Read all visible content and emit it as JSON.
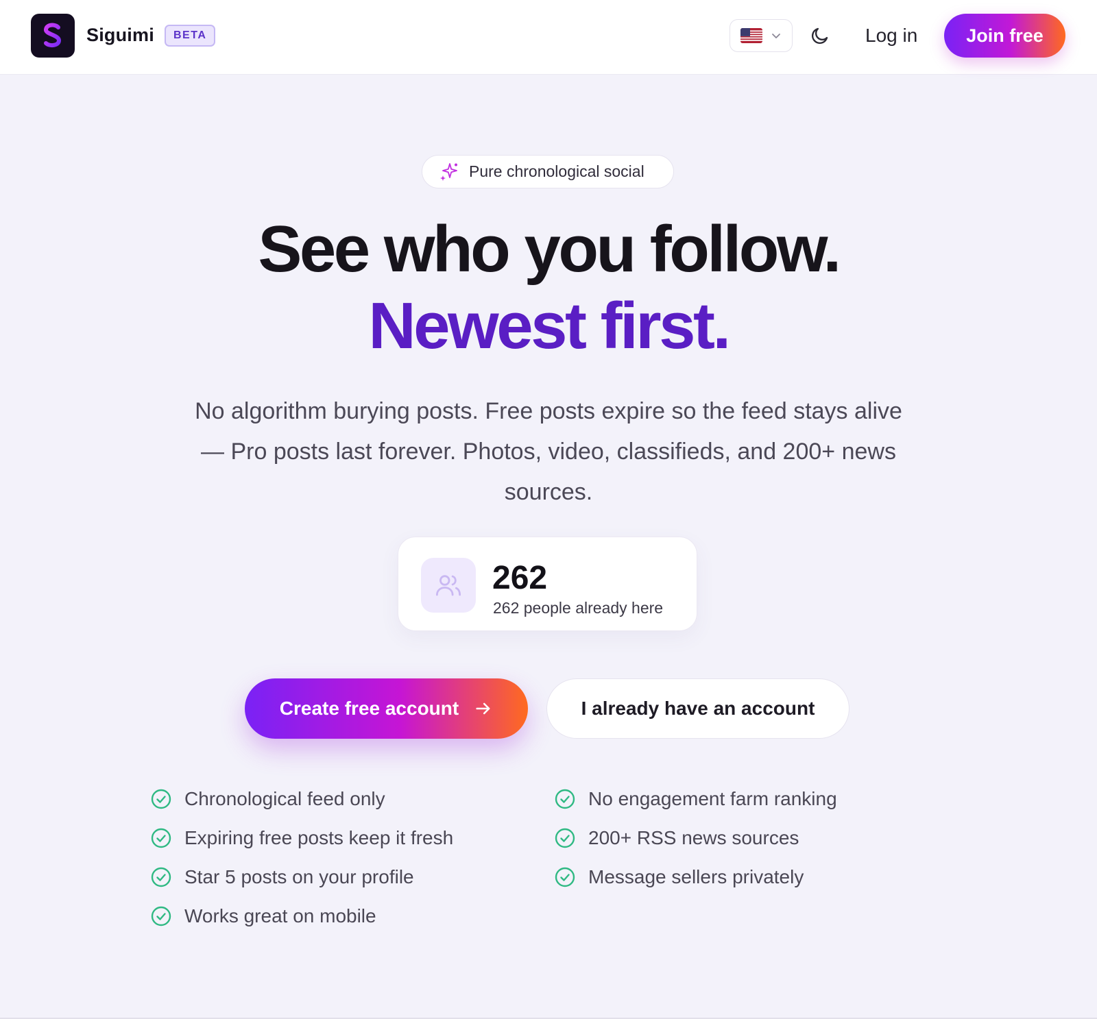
{
  "header": {
    "brand": "Siguimi",
    "beta_badge": "BETA",
    "language": {
      "selected": "🇺🇸"
    },
    "login_label": "Log in",
    "join_label": "Join free"
  },
  "hero": {
    "pill_text": "Pure chronological social",
    "headline_line1": "See who you follow.",
    "headline_line2": "Newest first.",
    "subtitle": "No algorithm burying posts. Free posts expire so the feed stays alive — Pro posts last forever. Photos, video, classifieds, and 200+ news sources.",
    "stat": {
      "number": "262",
      "label": "262 people already here"
    },
    "cta_primary": "Create free account",
    "cta_secondary": "I already have an account"
  },
  "features": {
    "left": [
      "Chronological feed only",
      "Expiring free posts keep it fresh",
      "Star 5 posts on your profile",
      "Works great on mobile"
    ],
    "right": [
      "No engagement farm ranking",
      "200+ RSS news sources",
      "Message sellers privately"
    ]
  },
  "colors": {
    "accent_purple": "#5a1ec4",
    "gradient_start": "#7a22f5",
    "gradient_mid": "#c615d4",
    "gradient_end": "#ff6a1f",
    "check_green": "#2fb983",
    "page_background": "#f3f2fa"
  },
  "icons": {
    "logo": "s-logo-icon",
    "language": "us-flag-icon",
    "language_toggle": "chevron-down-icon",
    "theme": "moon-icon",
    "pill": "sparkles-icon",
    "stat": "users-icon",
    "cta": "arrow-right-icon",
    "feature": "check-circle-icon"
  }
}
